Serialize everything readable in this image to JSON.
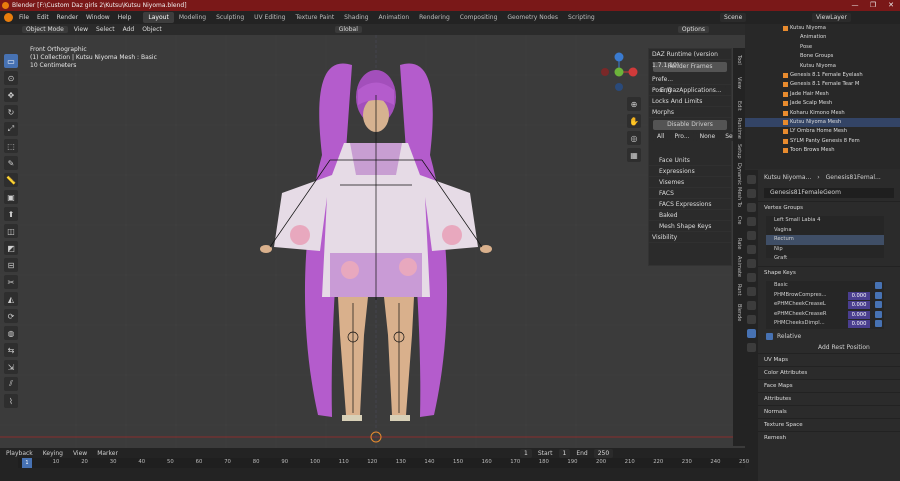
{
  "window": {
    "title": "Blender [F:\\Custom Daz girls 2\\Kutsu\\Kutsu Niyoma.blend]",
    "min": "—",
    "max": "❐",
    "close": "✕"
  },
  "menu": [
    "File",
    "Edit",
    "Render",
    "Window",
    "Help"
  ],
  "workspaces": [
    "Layout",
    "Modeling",
    "Sculpting",
    "UV Editing",
    "Texture Paint",
    "Shading",
    "Animation",
    "Rendering",
    "Compositing",
    "Geometry Nodes",
    "Scripting"
  ],
  "scene": {
    "name": "Scene",
    "view_layer": "ViewLayer"
  },
  "header3d": {
    "mode": "Object Mode",
    "view": "View",
    "select": "Select",
    "add": "Add",
    "object": "Object",
    "orientation": "Global",
    "options": "Options"
  },
  "viewport": {
    "view_name": "Front Orthographic",
    "collection": "(1) Collection | Kutsu Niyoma Mesh : Basic",
    "scale": "10 Centimeters"
  },
  "npanel": {
    "title": "DAZ Runtime (version 1.7.1.10)",
    "render_frames": "Render Frames",
    "prefix_label": "Prefe...",
    "prefix_value": "E:/DazApplications...",
    "sections": [
      "Posing",
      "Locks And Limits",
      "Morphs"
    ],
    "disable_drivers": "Disable Drivers",
    "morph_buttons": [
      "All",
      "Pro...",
      "None",
      "Set..."
    ],
    "morph_groups": [
      "Face Units",
      "Expressions",
      "Visemes",
      "FACS",
      "FACS Expressions",
      "Baked",
      "Mesh Shape Keys"
    ],
    "visibility": "Visibility"
  },
  "vtabs": [
    "Tool",
    "View",
    "Edit",
    "DAZ Runtime",
    "Setup",
    "Bone Dynamic",
    "Mesh To",
    "Cre",
    "Vimd Rate",
    "Animate",
    "DAZ Runt",
    "Blende"
  ],
  "outliner": [
    "Kutsu Niyoma",
    "Animation",
    "Pose",
    "Bone Groups",
    "Kutsu Niyoma",
    "Genesis 8.1 Female Eyelash",
    "Genesis 8.1 Female Tear M",
    "Jade Hair Mesh",
    "Jade Scalp Mesh",
    "Koharu Kimono Mesh",
    "Kutsu Niyoma Mesh",
    "LY Ombra Home Mesh",
    "SYLM Panty Genesis 8 Fem",
    "Toon Brows Mesh"
  ],
  "properties": {
    "breadcrumb_object": "Kutsu Niyoma...",
    "breadcrumb_mesh": "Genesis81Femal...",
    "mesh_name": "Genesis81FemaleGeom",
    "vertex_groups_title": "Vertex Groups",
    "vertex_groups": [
      "Left Small Labia 4",
      "Vagina",
      "Rectum",
      "Nip",
      "Graft"
    ],
    "selected_vg": 2,
    "shape_keys_title": "Shape Keys",
    "shape_keys": [
      {
        "name": "Basic",
        "value": ""
      },
      {
        "name": "PHMBrowCompres...",
        "value": "0.000"
      },
      {
        "name": "ePHMCheekCreaseL",
        "value": "0.000"
      },
      {
        "name": "ePHMCheekCreaseR",
        "value": "0.000"
      },
      {
        "name": "PHMCheeksDimpl...",
        "value": "0.000"
      }
    ],
    "relative": "Relative",
    "add_rest": "Add Rest Position",
    "sections": [
      "UV Maps",
      "Color Attributes",
      "Face Maps",
      "Attributes",
      "Normals",
      "Texture Space",
      "Remesh"
    ]
  },
  "timeline": {
    "menus": [
      "Playback",
      "Keying",
      "View",
      "Marker"
    ],
    "current_frame": "1",
    "start_label": "Start",
    "start": "1",
    "end_label": "End",
    "end": "250",
    "ticks": [
      "1",
      "10",
      "20",
      "30",
      "40",
      "50",
      "60",
      "70",
      "80",
      "90",
      "100",
      "110",
      "120",
      "130",
      "140",
      "150",
      "160",
      "170",
      "180",
      "190",
      "200",
      "210",
      "220",
      "230",
      "240",
      "250"
    ]
  },
  "colors": {
    "accent": "#4772b3",
    "titlebar": "#7a1818",
    "hair": "#b45ccc",
    "kimono": "#d8c2dc"
  }
}
